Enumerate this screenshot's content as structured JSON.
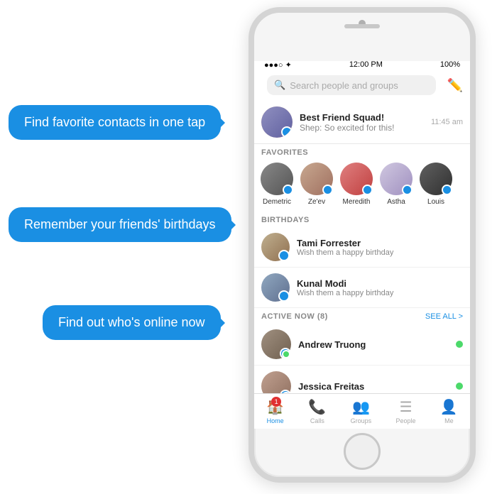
{
  "callouts": {
    "c1": "Find favorite contacts in one tap",
    "c2": "Remember your friends' birthdays",
    "c3": "Find out who's online now"
  },
  "statusBar": {
    "left": "●●●○ ✦",
    "center": "12:00 PM",
    "right": "100%"
  },
  "search": {
    "placeholder": "Search people and groups"
  },
  "conversation": {
    "name": "Best Friend Squad!",
    "sub": "Shep: So excited for this!",
    "time": "11:45 am"
  },
  "sections": {
    "favorites": "FAVORITES",
    "birthdays": "BIRTHDAYS",
    "activeNow": "ACTIVE NOW (8)",
    "seeAll": "SEE ALL >"
  },
  "favorites": [
    {
      "name": "Demetric"
    },
    {
      "name": "Ze'ev"
    },
    {
      "name": "Meredith"
    },
    {
      "name": "Astha"
    },
    {
      "name": "Louis"
    }
  ],
  "birthdays": [
    {
      "name": "Tami Forrester",
      "sub": "Wish them a happy birthday"
    },
    {
      "name": "Kunal Modi",
      "sub": "Wish them a happy birthday"
    }
  ],
  "activeNow": [
    {
      "name": "Andrew Truong"
    },
    {
      "name": "Jessica Freitas"
    }
  ],
  "tabs": [
    {
      "label": "Home",
      "active": true,
      "badge": "1"
    },
    {
      "label": "Calls",
      "active": false
    },
    {
      "label": "Groups",
      "active": false
    },
    {
      "label": "People",
      "active": false
    },
    {
      "label": "Me",
      "active": false
    }
  ]
}
